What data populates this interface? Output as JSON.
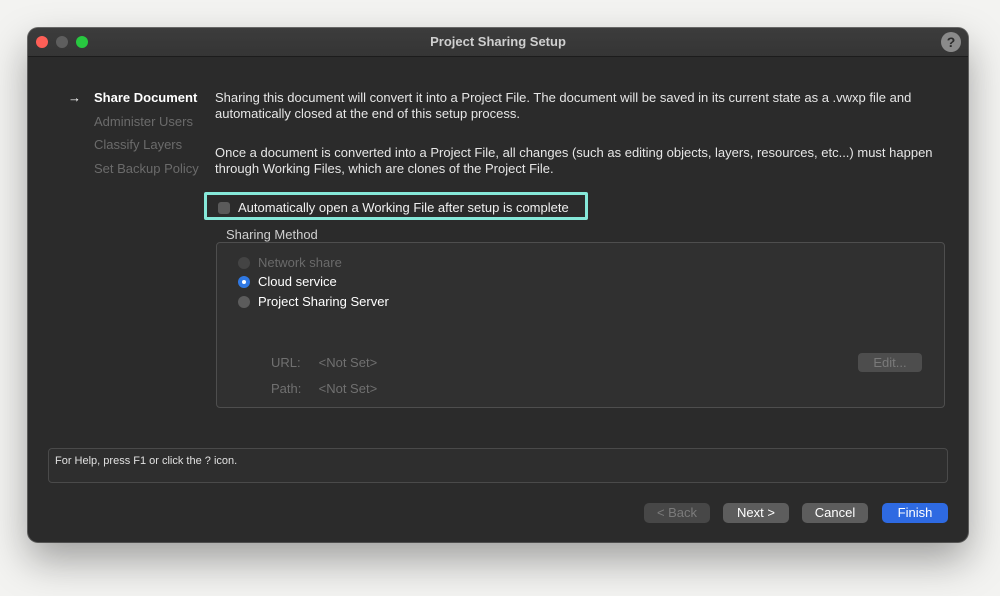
{
  "window": {
    "title": "Project Sharing Setup",
    "help_glyph": "?"
  },
  "steps": {
    "arrow": "→",
    "items": [
      {
        "label": "Share Document",
        "active": true
      },
      {
        "label": "Administer Users",
        "active": false
      },
      {
        "label": "Classify Layers",
        "active": false
      },
      {
        "label": "Set Backup Policy",
        "active": false
      }
    ]
  },
  "content": {
    "para1": "Sharing this document will convert it into a Project File. The document will be saved in its current state as a .vwxp file and automatically closed at the end of this setup process.",
    "para2": "Once a document is converted into a Project File, all changes (such as editing objects, layers, resources, etc...) must happen through Working Files, which are clones of the Project File.",
    "auto_open_label": "Automatically open a Working File after setup is complete",
    "auto_open_checked": false
  },
  "sharing_method": {
    "title": "Sharing Method",
    "options": [
      {
        "label": "Network share",
        "state": "disabled"
      },
      {
        "label": "Cloud service",
        "state": "selected"
      },
      {
        "label": "Project Sharing Server",
        "state": "unselected"
      }
    ],
    "url_label": "URL:",
    "url_value": "<Not Set>",
    "path_label": "Path:",
    "path_value": "<Not Set>",
    "edit_label": "Edit..."
  },
  "help_text": "For Help, press F1 or click the ? icon.",
  "buttons": {
    "back": "< Back",
    "next": "Next >",
    "cancel": "Cancel",
    "finish": "Finish"
  },
  "colors": {
    "accent_blue": "#2e6ae2",
    "highlight_outline": "#86e8d9",
    "close_red": "#fe5f57",
    "maximize_green": "#28c840"
  }
}
